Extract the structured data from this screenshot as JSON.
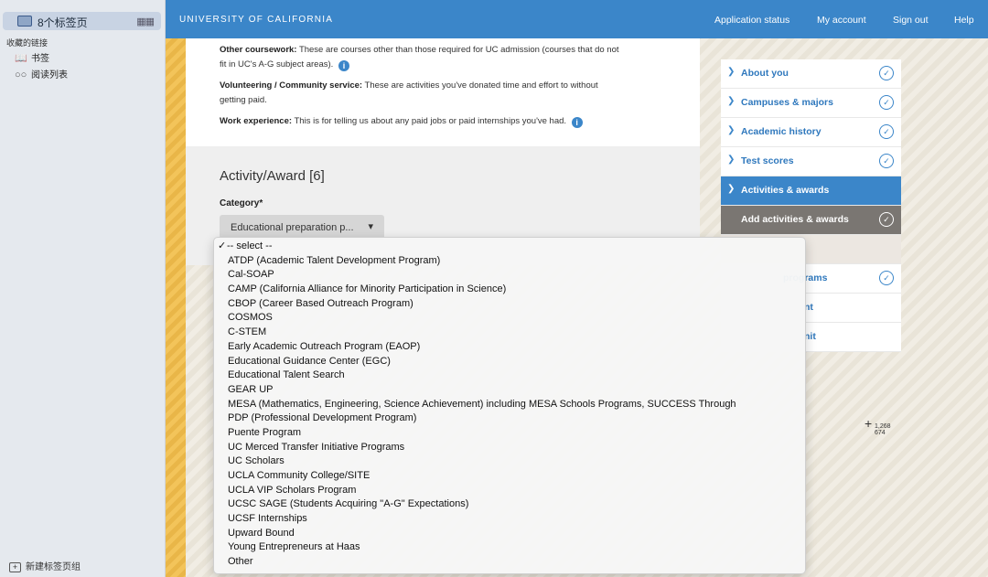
{
  "sidebar": {
    "tab_group": {
      "label": "8个标签页",
      "grid_icon": "grid-icon"
    },
    "favorites_title": "收藏的链接",
    "items": [
      {
        "label": "书签",
        "icon": "book-icon"
      },
      {
        "label": "阅读列表",
        "icon": "glasses-icon"
      }
    ],
    "new_group_label": "新建标签页组"
  },
  "header": {
    "brand": "UNIVERSITY OF CALIFORNIA",
    "nav": [
      "Application status",
      "My account",
      "Sign out",
      "Help"
    ],
    "color": "#3b86c9"
  },
  "content": {
    "other_coursework_title": "Other coursework:",
    "other_coursework_text": "These are courses other than those required for UC admission (courses that do not fit in UC's A-G subject areas).",
    "volunteering_title": "Volunteering / Community service:",
    "volunteering_text": "These are activities you've donated time and effort to without getting paid.",
    "work_title": "Work experience:",
    "work_text": "This is for telling us about any paid jobs or paid internships you've had.",
    "activity_title": "Activity/Award [6]",
    "category_label": "Category*",
    "category_value": "Educational preparation p..."
  },
  "right_nav": {
    "items": [
      {
        "label": "About you",
        "state": "done"
      },
      {
        "label": "Campuses & majors",
        "state": "done"
      },
      {
        "label": "Academic history",
        "state": "done"
      },
      {
        "label": "Test scores",
        "state": "done"
      },
      {
        "label": "Activities & awards",
        "state": "active"
      },
      {
        "label": "Add activities & awards",
        "state": "sub"
      },
      {
        "label": "",
        "state": "blank"
      },
      {
        "label": "programs",
        "state": "done-partial"
      },
      {
        "label": "nt",
        "state": "partial"
      },
      {
        "label": "nit",
        "state": "partial"
      }
    ]
  },
  "cursor": {
    "line1": "1,268",
    "line2": "674"
  },
  "dropdown": {
    "selected": "-- select --",
    "options": [
      "-- select --",
      "ATDP (Academic Talent Development Program)",
      "Cal-SOAP",
      "CAMP (California Alliance for Minority Participation in Science)",
      "CBOP (Career Based Outreach Program)",
      "COSMOS",
      "C-STEM",
      "Early Academic Outreach Program (EAOP)",
      "Educational Guidance Center (EGC)",
      "Educational Talent Search",
      "GEAR UP",
      "MESA (Mathematics, Engineering, Science Achievement) including MESA Schools Programs, SUCCESS Through",
      "PDP (Professional Development Program)",
      "Puente Program",
      "UC Merced Transfer Initiative Programs",
      "UC Scholars",
      "UCLA Community College/SITE",
      "UCLA VIP Scholars Program",
      "UCSC SAGE (Students Acquiring \"A-G\" Expectations)",
      "UCSF Internships",
      "Upward Bound",
      "Young Entrepreneurs at Haas",
      "Other"
    ]
  }
}
